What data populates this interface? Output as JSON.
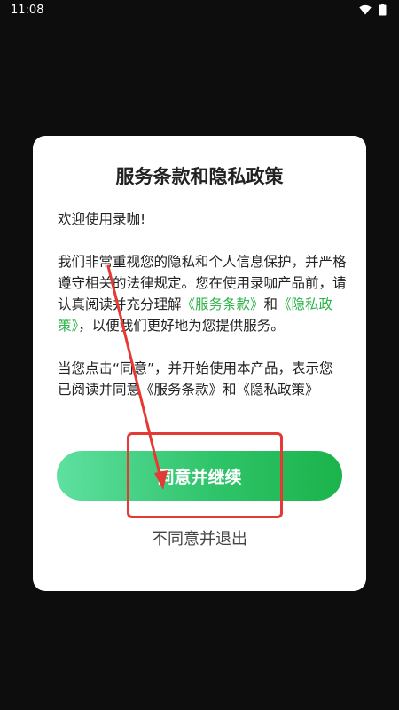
{
  "status_bar": {
    "time": "11:08"
  },
  "dialog": {
    "title": "服务条款和隐私政策",
    "welcome": "欢迎使用录咖!",
    "paragraph1": {
      "text_a": "我们非常重视您的隐私和个人信息保护，并严格遵守相关的法律规定。您在使用录咖产品前，请认真阅读并充分理解",
      "link_terms": "《服务条款》",
      "text_and": "和",
      "link_privacy": "《隐私政策》",
      "text_b": "，以便我们更好地为您提供服务。"
    },
    "paragraph2": "当您点击“同意”，并开始使用本产品，表示您已阅读并同意《服务条款》和《隐私政策》",
    "agree_label": "同意并继续",
    "disagree_label": "不同意并退出"
  },
  "colors": {
    "link": "#2db34a",
    "button_gradient_start": "#5fe0a0",
    "button_gradient_end": "#1bb34b",
    "annotation": "#e53935"
  },
  "icons": [
    "wifi-icon",
    "battery-icon"
  ]
}
